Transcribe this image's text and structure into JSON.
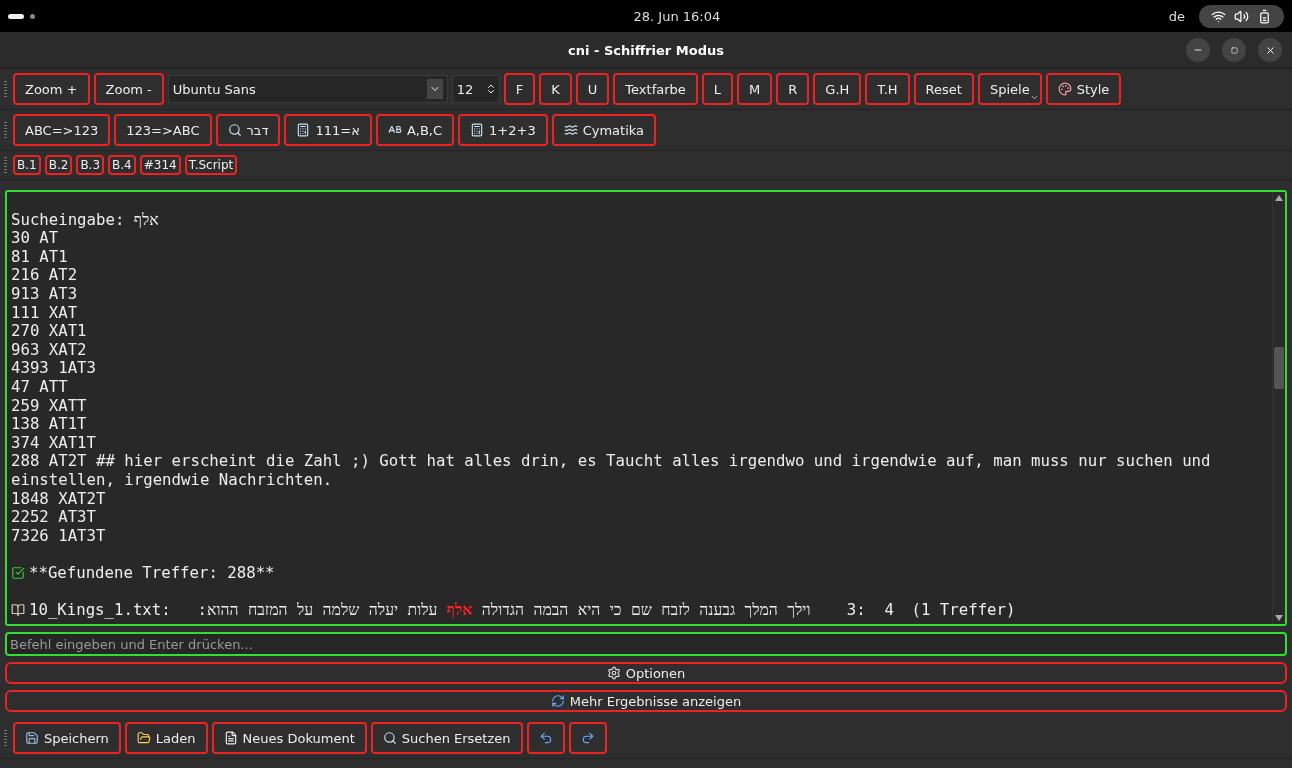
{
  "top_bar": {
    "clock": "28. Jun  16:04",
    "keyboard_layout": "de"
  },
  "window": {
    "title": "cni - Schiffrier Modus"
  },
  "toolbar_format": {
    "buttons_before": [
      {
        "label": "Zoom +"
      },
      {
        "label": "Zoom -"
      }
    ],
    "font_combo": {
      "value": "Ubuntu Sans"
    },
    "size_spin": {
      "value": "12"
    },
    "buttons_after": [
      {
        "label": "F",
        "kind": "text"
      },
      {
        "label": "K",
        "kind": "text"
      },
      {
        "label": "U",
        "kind": "text"
      },
      {
        "label": "Textfarbe",
        "kind": "text"
      },
      {
        "label": "L",
        "kind": "text"
      },
      {
        "label": "M",
        "kind": "text"
      },
      {
        "label": "R",
        "kind": "text"
      },
      {
        "label": "G.H",
        "kind": "text"
      },
      {
        "label": "T.H",
        "kind": "text"
      },
      {
        "label": "Reset",
        "kind": "text"
      },
      {
        "label": "Spiele",
        "kind": "menu"
      },
      {
        "label": "Style",
        "kind": "icon-text"
      }
    ]
  },
  "toolbar_convert": [
    {
      "label": "ABC=>123",
      "kind": "text"
    },
    {
      "label": "123=>ABC",
      "kind": "text"
    },
    {
      "label": "דבר",
      "kind": "icon-text"
    },
    {
      "label": "111=א",
      "kind": "icon-text"
    },
    {
      "label": "A,B,C",
      "kind": "icon-text"
    },
    {
      "label": "1+2+3",
      "kind": "icon-text"
    },
    {
      "label": "Cymatika",
      "kind": "icon-text"
    }
  ],
  "toolbar_books": [
    "B.1",
    "B.2",
    "B.3",
    "B.4",
    "#314",
    "T.Script"
  ],
  "output": {
    "lines": [
      {
        "kind": "blank"
      },
      {
        "kind": "text",
        "text": "Sucheingabe: אלף"
      },
      {
        "kind": "text",
        "text": "30 AT"
      },
      {
        "kind": "text",
        "text": "81 AT1"
      },
      {
        "kind": "text",
        "text": "216 AT2"
      },
      {
        "kind": "text",
        "text": "913 AT3"
      },
      {
        "kind": "text",
        "text": "111 XAT"
      },
      {
        "kind": "text",
        "text": "270 XAT1"
      },
      {
        "kind": "text",
        "text": "963 XAT2"
      },
      {
        "kind": "text",
        "text": "4393 1AT3"
      },
      {
        "kind": "text",
        "text": "47 ATT"
      },
      {
        "kind": "text",
        "text": "259 XATT"
      },
      {
        "kind": "text",
        "text": "138 AT1T"
      },
      {
        "kind": "text",
        "text": "374 XAT1T"
      },
      {
        "kind": "text",
        "text": "288 AT2T ## hier erscheint die Zahl ;) Gott hat alles drin, es Taucht alles irgendwo und irgendwie auf, man muss nur suchen und einstellen, irgendwie Nachrichten."
      },
      {
        "kind": "text",
        "text": "1848 XAT2T"
      },
      {
        "kind": "text",
        "text": "2252 AT3T"
      },
      {
        "kind": "text",
        "text": "7326 1AT3T"
      },
      {
        "kind": "blank"
      },
      {
        "kind": "found",
        "text": "**Gefundene Treffer: 288**"
      },
      {
        "kind": "blank"
      },
      {
        "kind": "result",
        "file": "10_Kings_1.txt:",
        "verse_before": "וילך המלך גבענה לזבח שם כי היא הבמה הגדולה",
        "match": "אלף",
        "verse_after": "עלות יעלה שלמה על המזבח ההוא:",
        "reference": "3:  4",
        "count": "(1 Treffer)"
      }
    ]
  },
  "command_input": {
    "placeholder": "Befehl eingeben und Enter drücken..."
  },
  "options_button": {
    "label": "Optionen"
  },
  "more_button": {
    "label": "Mehr Ergebnisse anzeigen"
  },
  "toolbar_file": [
    {
      "label": "Speichern",
      "kind": "icon-text"
    },
    {
      "label": "Laden",
      "kind": "icon-text"
    },
    {
      "label": "Neues Dokument",
      "kind": "icon-text"
    },
    {
      "label": "Suchen  Ersetzen",
      "kind": "icon-text"
    },
    {
      "kind": "icon"
    },
    {
      "kind": "icon"
    }
  ]
}
